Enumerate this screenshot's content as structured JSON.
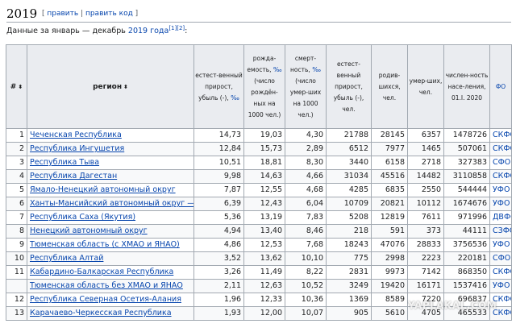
{
  "section": {
    "title": "2019",
    "edit_open": "[ ",
    "edit_label": "править",
    "edit_sep": " | ",
    "edit_code_label": "править код",
    "edit_close": " ]"
  },
  "intro": {
    "text": "Данные за январь — декабрь ",
    "link": "2019 года",
    "ref1": "[1]",
    "ref2": "[2]",
    "colon": ":"
  },
  "table": {
    "headers": {
      "num": "#",
      "region": "регион",
      "natural_growth_pct_a": "естест-венный прирост, убыль (-), ",
      "natural_growth_pct_b": "‰",
      "birth_rate_a": "рожда-емость, ",
      "birth_rate_b": "‰",
      "birth_rate_c": " (число рождён-ных на 1000 чел.)",
      "death_rate_a": "смерт-ность, ",
      "death_rate_b": "‰",
      "death_rate_c": " (число умер-ших на 1000 чел.)",
      "natural_growth_abs": "естест-венный прирост, убыль (-), чел.",
      "births": "родив-шихся, чел.",
      "deaths": "умер-ших, чел.",
      "population": "числен-ность насе-ления, 01.I. 2020",
      "fo": "ФО",
      "sort_glyph": "⬍"
    },
    "rows": [
      {
        "num": "1",
        "region": "Чеченская Республика",
        "growth": "14,73",
        "birth": "19,03",
        "death": "4,30",
        "growth_abs": "21788",
        "births": "28145",
        "deaths": "6357",
        "population": "1478726",
        "fo": "СКФО"
      },
      {
        "num": "2",
        "region": "Республика Ингушетия",
        "growth": "12,84",
        "birth": "15,73",
        "death": "2,89",
        "growth_abs": "6512",
        "births": "7977",
        "deaths": "1465",
        "population": "507061",
        "fo": "СКФО"
      },
      {
        "num": "3",
        "region": "Республика Тыва",
        "growth": "10,51",
        "birth": "18,81",
        "death": "8,30",
        "growth_abs": "3440",
        "births": "6158",
        "deaths": "2718",
        "population": "327383",
        "fo": "СФО"
      },
      {
        "num": "4",
        "region": "Республика Дагестан",
        "growth": "9,98",
        "birth": "14,63",
        "death": "4,66",
        "growth_abs": "31034",
        "births": "45516",
        "deaths": "14482",
        "population": "3110858",
        "fo": "СКФО"
      },
      {
        "num": "5",
        "region": "Ямало-Ненецкий автономный округ",
        "growth": "7,87",
        "birth": "12,55",
        "death": "4,68",
        "growth_abs": "4285",
        "births": "6835",
        "deaths": "2550",
        "population": "544444",
        "fo": "УФО"
      },
      {
        "num": "6",
        "region": "Ханты-Мансийский автономный округ — Югра",
        "growth": "6,39",
        "birth": "12,43",
        "death": "6,04",
        "growth_abs": "10709",
        "births": "20821",
        "deaths": "10112",
        "population": "1674676",
        "fo": "УФО"
      },
      {
        "num": "7",
        "region": "Республика Саха (Якутия)",
        "growth": "5,36",
        "birth": "13,19",
        "death": "7,83",
        "growth_abs": "5208",
        "births": "12819",
        "deaths": "7611",
        "population": "971996",
        "fo": "ДВФО"
      },
      {
        "num": "8",
        "region": "Ненецкий автономный округ",
        "growth": "4,94",
        "birth": "13,40",
        "death": "8,46",
        "growth_abs": "218",
        "births": "591",
        "deaths": "373",
        "population": "44111",
        "fo": "СЗФО"
      },
      {
        "num": "9",
        "region": "Тюменская область (с ХМАО и ЯНАО)",
        "growth": "4,86",
        "birth": "12,53",
        "death": "7,68",
        "growth_abs": "18243",
        "births": "47076",
        "deaths": "28833",
        "population": "3756536",
        "fo": "УФО"
      },
      {
        "num": "10",
        "region": "Республика Алтай",
        "growth": "3,52",
        "birth": "13,62",
        "death": "10,10",
        "growth_abs": "775",
        "births": "2998",
        "deaths": "2223",
        "population": "220181",
        "fo": "СФО"
      },
      {
        "num": "11",
        "region": "Кабардино-Балкарская Республика",
        "growth": "3,26",
        "birth": "11,49",
        "death": "8,22",
        "growth_abs": "2831",
        "births": "9973",
        "deaths": "7142",
        "population": "868350",
        "fo": "СКФО"
      },
      {
        "num": "",
        "region": "Тюменская область без ХМАО и ЯНАО",
        "growth": "2,11",
        "birth": "12,63",
        "death": "10,52",
        "growth_abs": "3249",
        "births": "19420",
        "deaths": "16171",
        "population": "1537416",
        "fo": "УФО"
      },
      {
        "num": "12",
        "region": "Республика Северная Осетия-Алания",
        "growth": "1,96",
        "birth": "12,33",
        "death": "10,36",
        "growth_abs": "1369",
        "births": "8589",
        "deaths": "7220",
        "population": "696837",
        "fo": "СКФО"
      },
      {
        "num": "13",
        "region": "Карачаево-Черкесская Республика",
        "growth": "1,93",
        "birth": "12,00",
        "death": "10,07",
        "growth_abs": "905",
        "births": "5610",
        "deaths": "4705",
        "population": "465533",
        "fo": "СКФО"
      }
    ]
  },
  "watermark": "YAPLAKAL.COM"
}
